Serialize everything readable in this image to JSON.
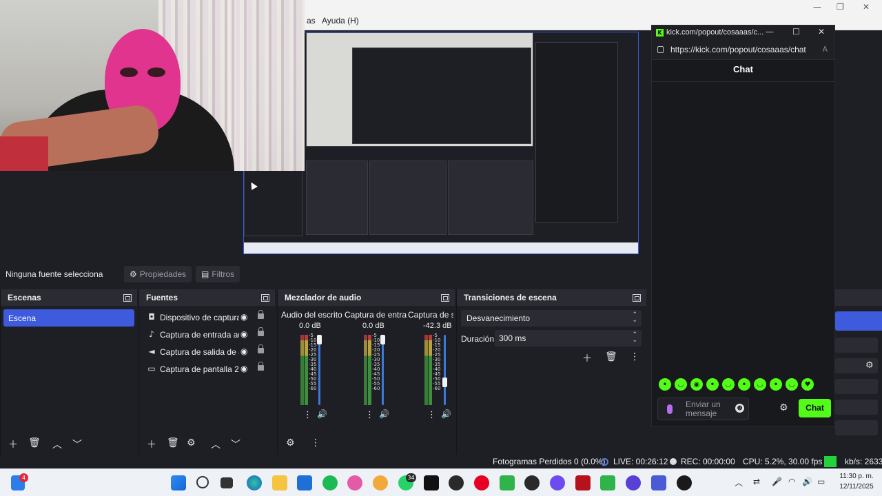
{
  "colors": {
    "accent": "#3d5bdc",
    "panel": "#1e1f25",
    "header": "#2b2c33",
    "kick_green": "#53fc18",
    "live_green": "#22d33a"
  },
  "obs": {
    "menu_fragment": "as",
    "menu_help": "Ayuda (H)"
  },
  "chat": {
    "window_title": "kick.com/popout/cosaaas/c...",
    "url": "https://kick.com/popout/cosaaas/chat",
    "heading": "Chat",
    "input_placeholder": "Enviar un mensaje",
    "send_label": "Chat",
    "emote_count": 10
  },
  "source_bar": {
    "no_source": "Ninguna fuente selecciona",
    "properties": "Propiedades",
    "filters": "Filtros"
  },
  "scenes": {
    "title": "Escenas",
    "items": [
      "Escena"
    ]
  },
  "sources": {
    "title": "Fuentes",
    "items": [
      {
        "label": "Dispositivo de captura",
        "icon": "camera-icon"
      },
      {
        "label": "Captura de entrada au",
        "icon": "microphone-icon"
      },
      {
        "label": "Captura de salida de a",
        "icon": "speaker-icon"
      },
      {
        "label": "Captura de pantalla 2",
        "icon": "monitor-icon"
      }
    ]
  },
  "mixer": {
    "title": "Mezclador de audio",
    "channels": [
      {
        "name": "Audio del escrito",
        "db": "0.0 dB",
        "level": 1.0
      },
      {
        "name": "Captura de entra",
        "db": "0.0 dB",
        "level": 1.0
      },
      {
        "name": "Captura de sa",
        "db": "-42.3 dB",
        "level": 0.3
      }
    ],
    "scale": [
      "-5",
      "-10",
      "-15",
      "-20",
      "-25",
      "-30",
      "-35",
      "-40",
      "-45",
      "-50",
      "-55",
      "-60"
    ]
  },
  "transitions": {
    "title": "Transiciones de escena",
    "selected": "Desvanecimiento",
    "duration_label": "Duración",
    "duration_value": "300 ms"
  },
  "status": {
    "dropped": "Fotogramas Perdidos 0 (0.0%)",
    "live": "LIVE: 00:26:12",
    "rec": "REC: 00:00:00",
    "cpu": "CPU: 5.2%, 30.00 fps",
    "bitrate": "kb/s: 2633"
  },
  "taskbar": {
    "widget_badge": "4",
    "whatsapp_badge": "34",
    "time": "11:30 p. m.",
    "date": "12/11/2025"
  }
}
